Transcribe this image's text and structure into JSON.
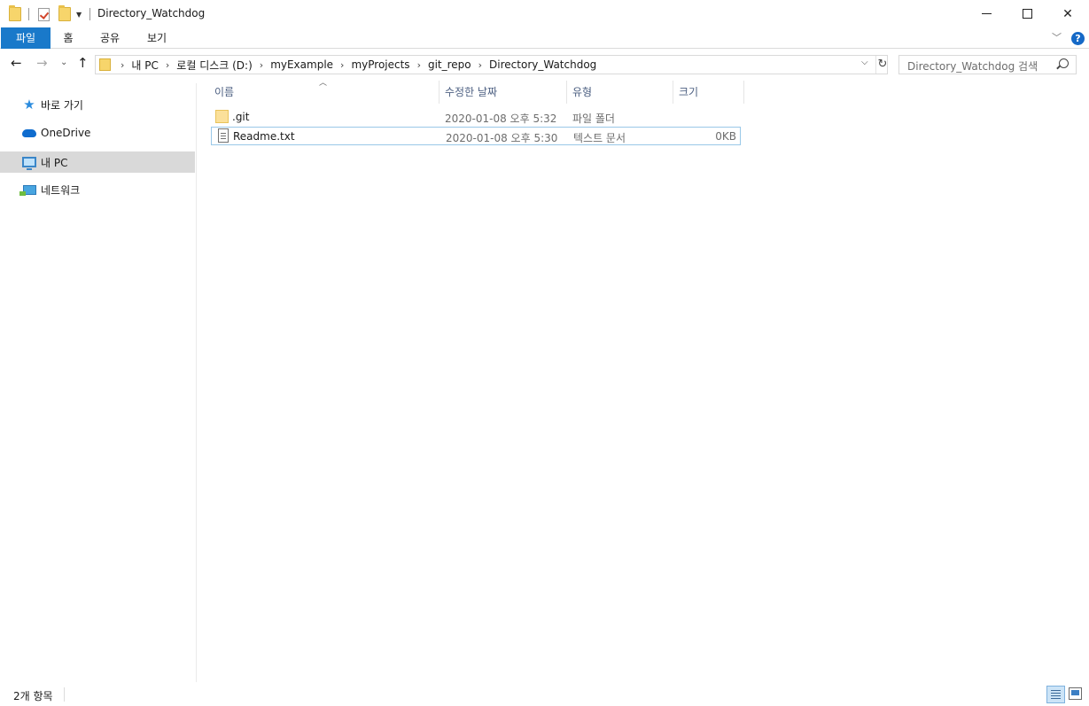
{
  "window": {
    "title": "Directory_Watchdog",
    "minimize_glyph": "",
    "close_glyph": "✕"
  },
  "ribbon": {
    "tabs": [
      "파일",
      "홈",
      "공유",
      "보기"
    ],
    "help_glyph": "?"
  },
  "address": {
    "crumbs": [
      "내 PC",
      "로컬 디스크 (D:)",
      "myExample",
      "myProjects",
      "git_repo",
      "Directory_Watchdog"
    ]
  },
  "search": {
    "placeholder": "Directory_Watchdog 검색"
  },
  "nav": {
    "items": [
      {
        "label": "바로 가기",
        "icon": "star-icon"
      },
      {
        "label": "OneDrive",
        "icon": "cloud-icon"
      },
      {
        "label": "내 PC",
        "icon": "pc-icon",
        "selected": true
      },
      {
        "label": "네트워크",
        "icon": "network-icon"
      }
    ]
  },
  "columns": {
    "name": "이름",
    "date": "수정한 날짜",
    "type": "유형",
    "size": "크기"
  },
  "files": [
    {
      "name": ".git",
      "date": "2020-01-08 오후 5:32",
      "type": "파일 폴더",
      "size": "",
      "icon": "folder-icon"
    },
    {
      "name": "Readme.txt",
      "date": "2020-01-08 오후 5:30",
      "type": "텍스트 문서",
      "size": "0KB",
      "icon": "text-document-icon"
    }
  ],
  "status": {
    "item_count": "2개 항목"
  }
}
